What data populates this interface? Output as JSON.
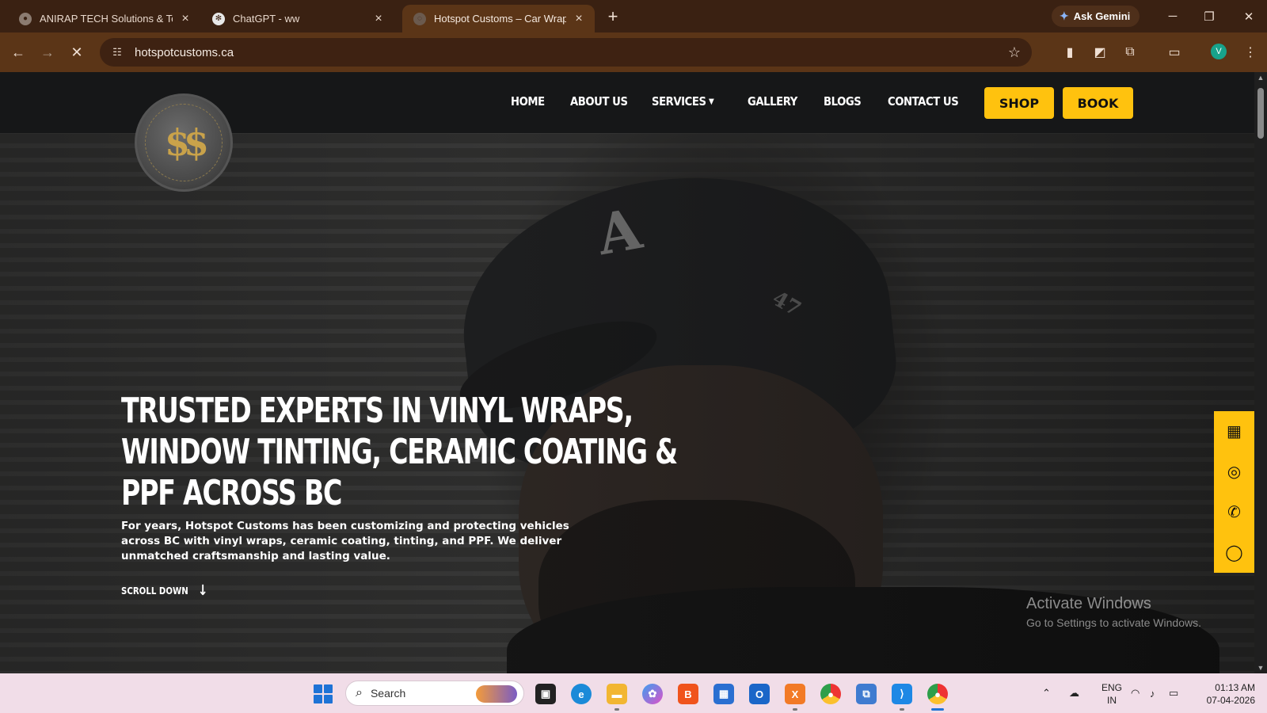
{
  "browser": {
    "tabs": [
      {
        "label": "ANIRAP TECH Solutions & Tech",
        "active": false
      },
      {
        "label": "ChatGPT - ww",
        "active": false
      },
      {
        "label": "Hotspot Customs – Car Wraps &",
        "active": true
      }
    ],
    "new_tab_icon": "plus-icon",
    "ask_gemini_label": "Ask Gemini",
    "url": "hotspotcustoms.ca",
    "profile_initial": "V"
  },
  "site": {
    "nav": {
      "home": "HOME",
      "about": "ABOUT US",
      "services": "SERVICES",
      "gallery": "GALLERY",
      "blogs": "BLOGS",
      "contact": "CONTACT US"
    },
    "shop_label": "SHOP",
    "book_label": "BOOK",
    "hero": {
      "title_line1": "TRUSTED EXPERTS IN VINYL WRAPS,",
      "title_line2": "WINDOW TINTING, CERAMIC COATING &",
      "title_line3": "PPF ACROSS BC",
      "description": "For years, Hotspot Customs has been customizing and protecting vehicles across BC with vinyl wraps, ceramic coating, tinting, and PPF. We deliver unmatched craftsmanship and lasting value.",
      "scroll_label": "SCROLL DOWN"
    },
    "social_icons": [
      "calendar-icon",
      "instagram-icon",
      "phone-icon",
      "whatsapp-icon"
    ],
    "accent_color": "#ffc20e"
  },
  "os": {
    "activate_title": "Activate Windows",
    "activate_sub": "Go to Settings to activate Windows.",
    "search_placeholder": "Search",
    "lang_line1": "ENG",
    "lang_line2": "IN",
    "time": "01:13 AM",
    "date": "07-04-2026"
  }
}
